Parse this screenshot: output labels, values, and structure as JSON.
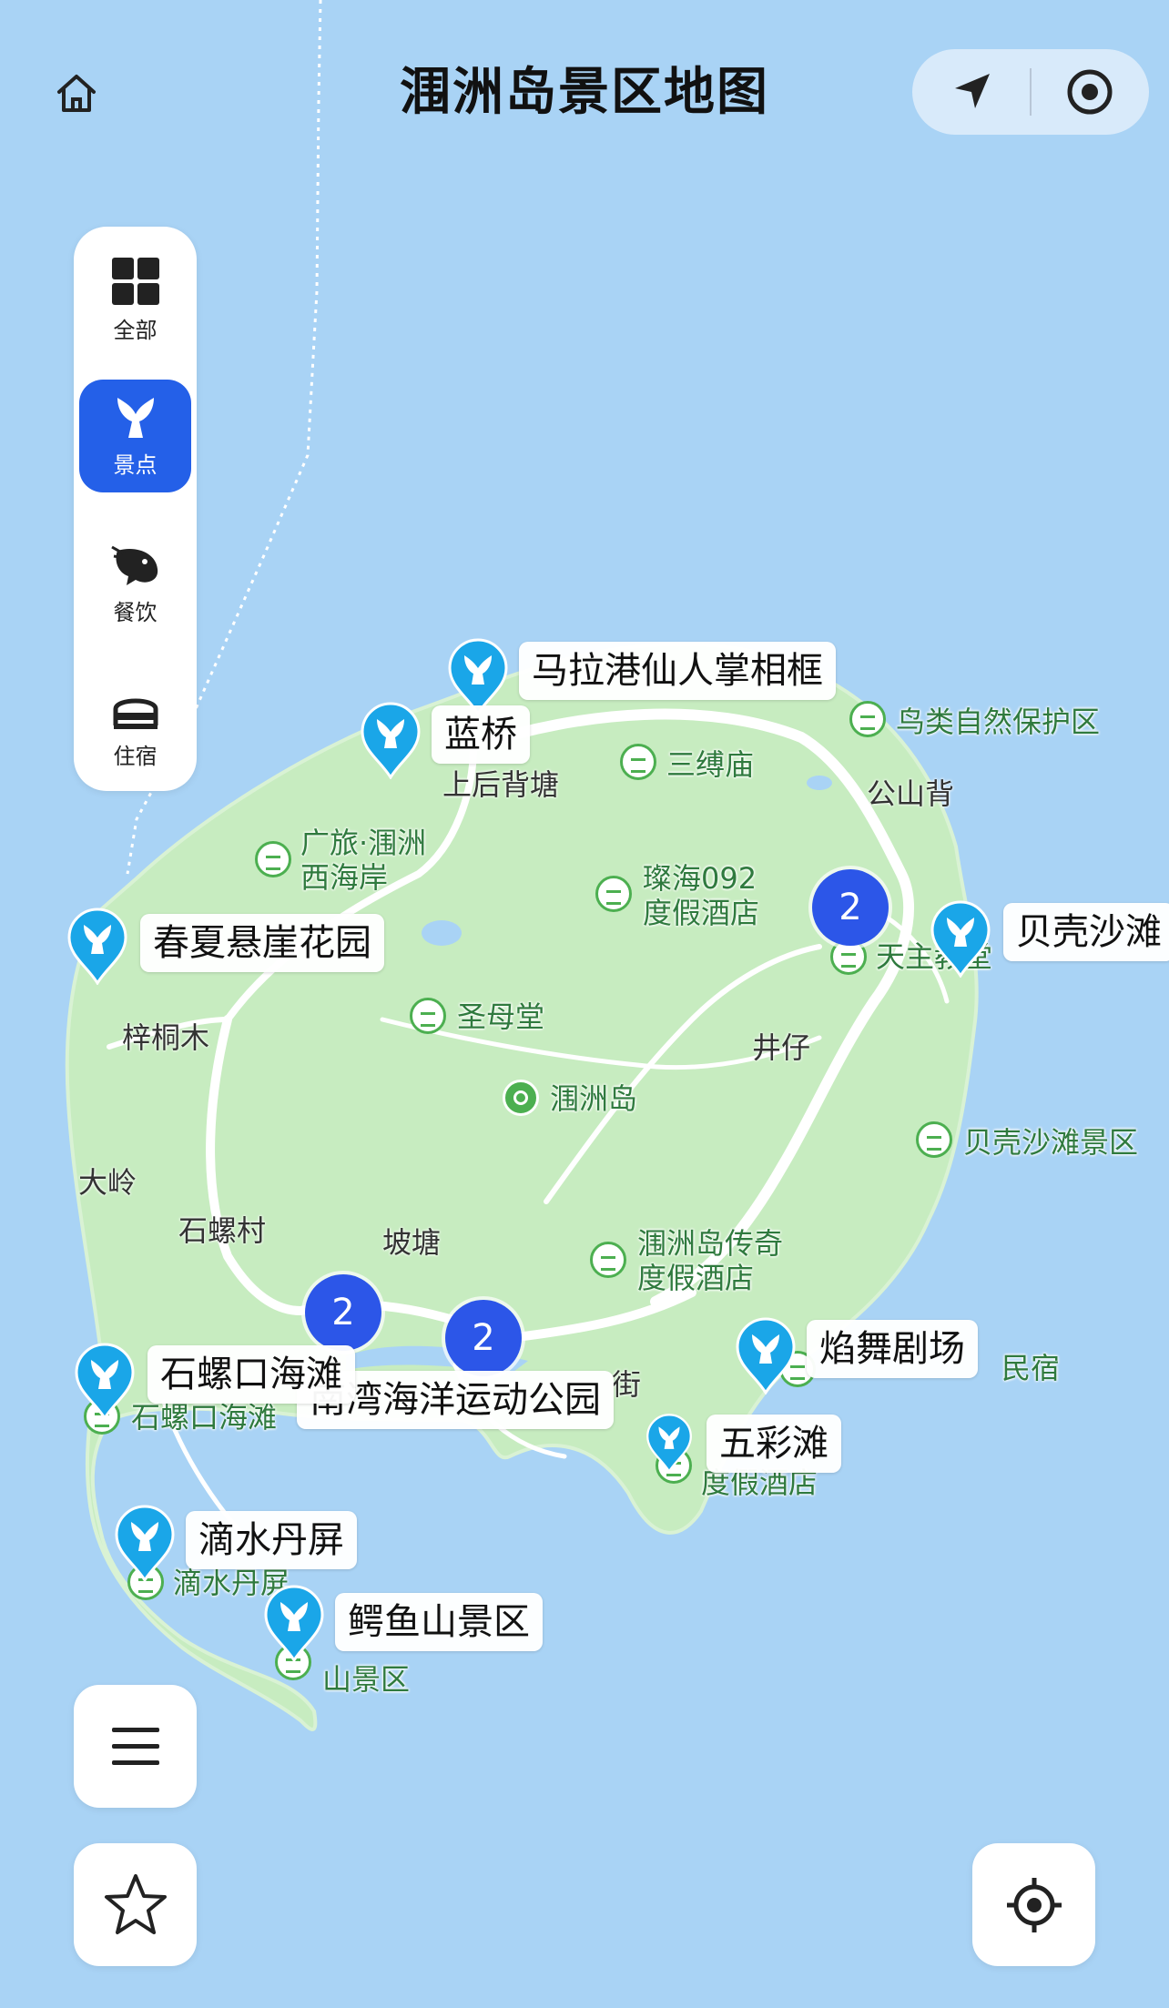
{
  "header": {
    "title": "涠洲岛景区地图",
    "home_icon": "home-icon",
    "navigate_icon": "navigation-arrow-icon",
    "record_icon": "target-record-icon"
  },
  "categories": [
    {
      "label": "全部",
      "icon": "grid-icon",
      "active": false
    },
    {
      "label": "景点",
      "icon": "whale-tail-icon",
      "active": true
    },
    {
      "label": "餐饮",
      "icon": "shrimp-icon",
      "active": false
    },
    {
      "label": "住宿",
      "icon": "bed-icon",
      "active": false
    }
  ],
  "scenic_pins": [
    {
      "name": "马拉港仙人掌相框"
    },
    {
      "name": "蓝桥"
    },
    {
      "name": "春夏悬崖花园"
    },
    {
      "name": "贝壳沙滩"
    },
    {
      "name": "石螺口海滩"
    },
    {
      "name": "南湾海洋运动公园"
    },
    {
      "name": "焰舞剧场"
    },
    {
      "name": "五彩滩"
    },
    {
      "name": "滴水丹屏"
    },
    {
      "name": "鳄鱼山景区"
    }
  ],
  "clusters": [
    {
      "count": "2"
    },
    {
      "count": "2"
    },
    {
      "count": "2"
    }
  ],
  "poi_labels": [
    {
      "text": "鸟类自然保护区"
    },
    {
      "text": "三缚庙"
    },
    {
      "text": "广旅·涠洲"
    },
    {
      "text": "西海岸"
    },
    {
      "text": "璨海092"
    },
    {
      "text": "度假酒店"
    },
    {
      "text": "天主教堂"
    },
    {
      "text": "圣母堂"
    },
    {
      "text": "涠洲岛"
    },
    {
      "text": "贝壳沙滩景区"
    },
    {
      "text": "涠洲岛传奇"
    },
    {
      "text": "度假酒店"
    },
    {
      "text": "民宿"
    },
    {
      "text": "石螺口海滩"
    },
    {
      "text": "度假酒店"
    },
    {
      "text": "滴水丹屏"
    },
    {
      "text": "山景区"
    }
  ],
  "place_labels": [
    {
      "text": "上后背塘"
    },
    {
      "text": "公山背"
    },
    {
      "text": "梓桐木"
    },
    {
      "text": "井仔"
    },
    {
      "text": "大岭"
    },
    {
      "text": "石螺村"
    },
    {
      "text": "坡塘"
    },
    {
      "text": "街"
    }
  ],
  "buttons": {
    "menu_icon": "menu-icon",
    "favorite_icon": "star-icon",
    "locate_icon": "locate-crosshair-icon"
  },
  "colors": {
    "sea": "#a9d3f5",
    "land": "#c7ecc0",
    "accent": "#2460e8",
    "pin": "#1aa6e8",
    "cluster": "#2c56e8",
    "poi_text": "#2f7a3e"
  }
}
